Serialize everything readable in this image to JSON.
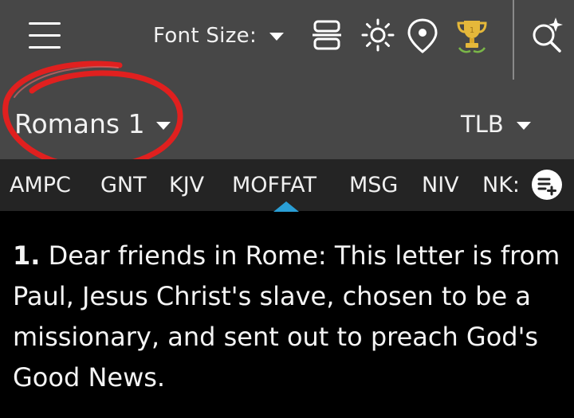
{
  "header": {
    "font_size_label": "Font Size:",
    "book": "Romans 1",
    "version": "TLB"
  },
  "icons": {
    "menu": "hamburger-menu-icon",
    "layout": "layout-toggle-icon",
    "brightness": "brightness-icon",
    "location": "location-pin-icon",
    "trophy": "trophy-icon",
    "search": "search-sparkle-icon",
    "add": "add-to-list-icon"
  },
  "tabs": [
    {
      "label": "AMPC"
    },
    {
      "label": "GNT"
    },
    {
      "label": "KJV"
    },
    {
      "label": "MOFFAT"
    },
    {
      "label": "MSG"
    },
    {
      "label": "NIV"
    },
    {
      "label": "NK:"
    }
  ],
  "verse": {
    "number": "1.",
    "text": " Dear friends in Rome: This letter is from Paul, Jesus Christ's slave, chosen to be a missionary, and sent out to preach God's Good News."
  },
  "colors": {
    "topbar": "#474747",
    "tabbar": "#242424",
    "accent": "#2a9fd6",
    "annotation": "#e0201f"
  }
}
